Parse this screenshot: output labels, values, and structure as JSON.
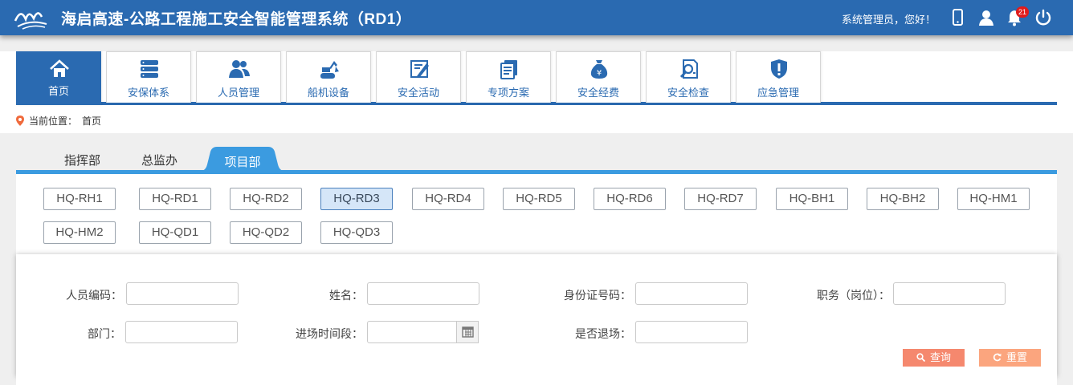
{
  "header": {
    "title": "海启高速-公路工程施工安全智能管理系统（RD1）",
    "greeting": "系统管理员，您好！",
    "notification_count": "21",
    "icons": [
      "mobile-icon",
      "user-icon",
      "bell-icon",
      "power-icon"
    ]
  },
  "nav": {
    "tabs": [
      {
        "label": "首页",
        "icon": "home-icon",
        "active": true
      },
      {
        "label": "安保体系",
        "icon": "database-icon"
      },
      {
        "label": "人员管理",
        "icon": "people-icon"
      },
      {
        "label": "船机设备",
        "icon": "excavator-icon"
      },
      {
        "label": "安全活动",
        "icon": "activity-icon"
      },
      {
        "label": "专项方案",
        "icon": "document-icon"
      },
      {
        "label": "安全经费",
        "icon": "money-bag-icon"
      },
      {
        "label": "安全检查",
        "icon": "inspect-icon"
      },
      {
        "label": "应急管理",
        "icon": "shield-icon"
      }
    ]
  },
  "breadcrumb": {
    "prefix": "当前位置：",
    "current": "首页"
  },
  "subtabs": {
    "items": [
      "指挥部",
      "总监办",
      "项目部"
    ],
    "active": "项目部"
  },
  "codes": {
    "items": [
      "HQ-RH1",
      "HQ-RD1",
      "HQ-RD2",
      "HQ-RD3",
      "HQ-RD4",
      "HQ-RD5",
      "HQ-RD6",
      "HQ-RD7",
      "HQ-BH1",
      "HQ-BH2",
      "HQ-HM1",
      "HQ-HM2",
      "HQ-QD1",
      "HQ-QD2",
      "HQ-QD3"
    ],
    "selected": "HQ-RD3"
  },
  "search": {
    "fields": {
      "code": {
        "label": "人员编码：",
        "value": ""
      },
      "name": {
        "label": "姓名：",
        "value": ""
      },
      "idcard": {
        "label": "身份证号码：",
        "value": ""
      },
      "position": {
        "label": "职务（岗位）：",
        "value": ""
      },
      "dept": {
        "label": "部门：",
        "value": ""
      },
      "period": {
        "label": "进场时间段：",
        "value": ""
      },
      "exited": {
        "label": "是否退场：",
        "value": ""
      }
    },
    "query_label": "查询",
    "reset_label": "重置"
  },
  "colors": {
    "primary": "#2a6ab1",
    "subtab_accent": "#3b9be0",
    "query_button": "#f5886e",
    "reset_button": "#fba57e",
    "badge": "#e01b1b"
  }
}
